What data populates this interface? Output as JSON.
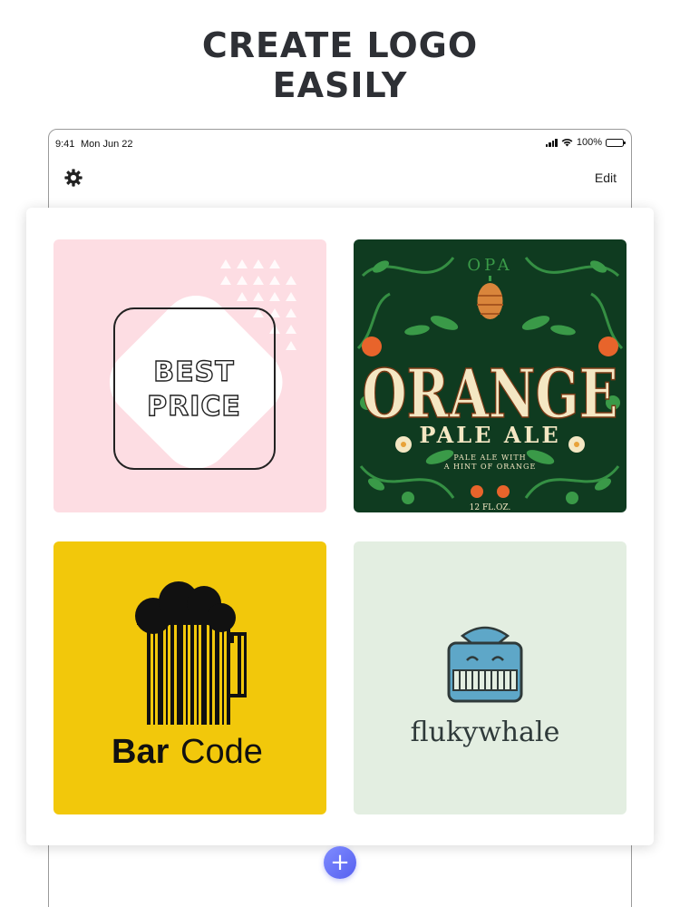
{
  "headline": {
    "line1": "CREATE LOGO",
    "line2": "EASILY"
  },
  "status_bar": {
    "time": "9:41",
    "date": "Mon Jun 22",
    "battery": "100%"
  },
  "nav": {
    "settings_icon": "gear-icon",
    "edit_label": "Edit"
  },
  "logos": [
    {
      "name": "best-price",
      "lines": [
        "BEST",
        "PRICE"
      ],
      "colors": {
        "background": "#fddde3",
        "diamond": "#ffffff",
        "text": "#222222"
      }
    },
    {
      "name": "orange-pale-ale",
      "top": "OPA",
      "title": "ORANGE",
      "subtitle": "PALE ALE",
      "tagline_line1": "PALE ALE WITH",
      "tagline_line2": "A HINT OF ORANGE",
      "volume": "12 FL.OZ.",
      "colors": {
        "background": "#0f3b20",
        "leaf": "#3a9a48",
        "title": "#f4e7c3",
        "orange": "#e8642b"
      }
    },
    {
      "name": "barcode",
      "label_bold": "Bar",
      "label_light": "Code",
      "colors": {
        "background": "#f2c80b",
        "ink": "#111111"
      }
    },
    {
      "name": "flukywhale",
      "label": "flukywhale",
      "colors": {
        "background": "#e3eee1",
        "whale": "#5ea7c8",
        "outline": "#2f3a3a"
      }
    }
  ],
  "fab": {
    "label": "+",
    "color": "#5c68f3"
  }
}
